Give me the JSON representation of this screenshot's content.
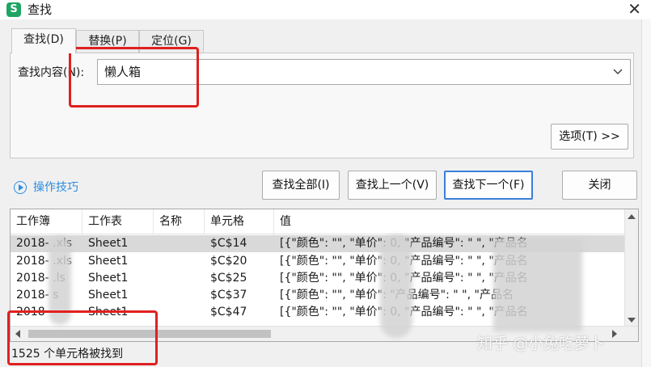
{
  "window": {
    "title": "查找",
    "app_icon": "S"
  },
  "tabs": [
    {
      "label": "查找(D)",
      "active": true
    },
    {
      "label": "替换(P)",
      "active": false
    },
    {
      "label": "定位(G)",
      "active": false
    }
  ],
  "find": {
    "label": "查找内容(N):",
    "value": "懒人箱"
  },
  "buttons": {
    "options": "选项(T) >>",
    "find_all": "查找全部(I)",
    "find_prev": "查找上一个(V)",
    "find_next": "查找下一个(F)",
    "close": "关闭"
  },
  "tips_label": "操作技巧",
  "results": {
    "columns": [
      "工作簿",
      "工作表",
      "名称",
      "单元格",
      "值"
    ],
    "rows": [
      {
        "workbook": "2018-  .xls",
        "sheet": "Sheet1",
        "name": "",
        "cell": "$C$14",
        "value": "[{\"颜色\": \"\", \"单价\":      0, \"产品编号\": \"             \", \"产品名"
      },
      {
        "workbook": "2018-  .xls",
        "sheet": "Sheet1",
        "name": "",
        "cell": "$C$20",
        "value": "[{\"颜色\": \"\", \"单价\":      0, \"产品编号\": \"             \", \"产品名"
      },
      {
        "workbook": "2018-  .ls",
        "sheet": "Sheet1",
        "name": "",
        "cell": "$C$25",
        "value": "[{\"颜色\": \"\", \"单价\":      0, \"产品编号\": \"             \", \"产品名"
      },
      {
        "workbook": "2018-  s",
        "sheet": "Sheet1",
        "name": "",
        "cell": "$C$37",
        "value": "[{\"颜色\": \"\", \"单价\":        \"产品编号\": \"             \", \"产品名"
      },
      {
        "workbook": "2018-  ",
        "sheet": "Sheet1",
        "name": "",
        "cell": "$C$47",
        "value": "[{\"颜色\": \"\", \"单价\":      0, \"产品编号\": \"             \", \"产品名"
      }
    ]
  },
  "status": "1525 个单元格被找到",
  "watermark": "知乎 @小兔吃萝卜",
  "colors": {
    "accent": "#3c7fd8",
    "annotation": "#e02020",
    "link": "#2b8de0",
    "selected_row": "#d9d9d9"
  }
}
